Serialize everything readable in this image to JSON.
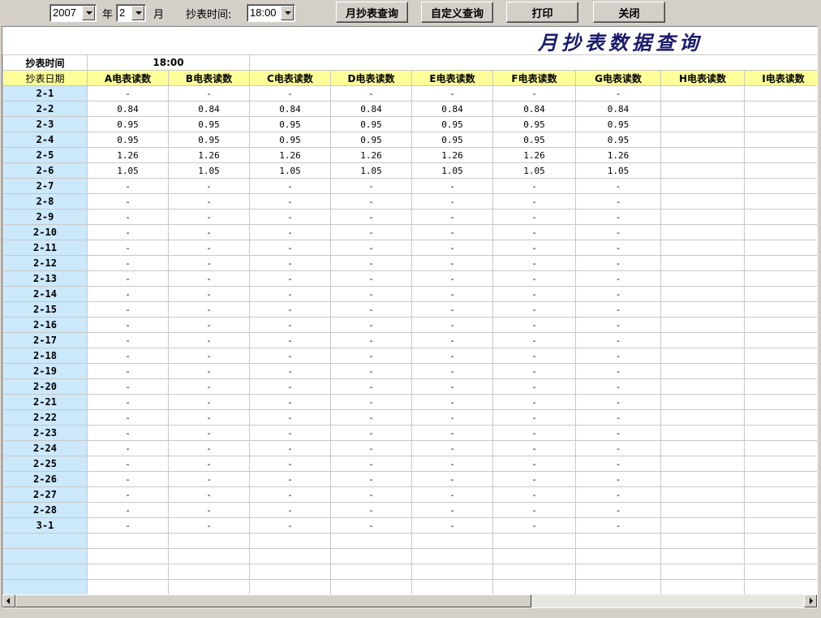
{
  "toolbar": {
    "year_value": "2007",
    "year_label": "年",
    "month_value": "2",
    "month_label": "月",
    "time_label": "抄表时间:",
    "time_value": "18:00",
    "buttons": {
      "monthly_query": "月抄表查询",
      "custom_query": "自定义查询",
      "print": "打印",
      "close": "关闭"
    }
  },
  "report": {
    "title": "月抄表数据查询",
    "time_header_label": "抄表时间",
    "time_header_value": "18:00",
    "date_col_header": "抄表日期",
    "columns": [
      "A电表读数",
      "B电表读数",
      "C电表读数",
      "D电表读数",
      "E电表读数",
      "F电表读数",
      "G电表读数",
      "H电表读数",
      "I电表读数"
    ],
    "rows": [
      {
        "date": "2-1",
        "values": [
          "-",
          "-",
          "-",
          "-",
          "-",
          "-",
          "-",
          "",
          ""
        ]
      },
      {
        "date": "2-2",
        "values": [
          "0.84",
          "0.84",
          "0.84",
          "0.84",
          "0.84",
          "0.84",
          "0.84",
          "",
          ""
        ]
      },
      {
        "date": "2-3",
        "values": [
          "0.95",
          "0.95",
          "0.95",
          "0.95",
          "0.95",
          "0.95",
          "0.95",
          "",
          ""
        ]
      },
      {
        "date": "2-4",
        "values": [
          "0.95",
          "0.95",
          "0.95",
          "0.95",
          "0.95",
          "0.95",
          "0.95",
          "",
          ""
        ]
      },
      {
        "date": "2-5",
        "values": [
          "1.26",
          "1.26",
          "1.26",
          "1.26",
          "1.26",
          "1.26",
          "1.26",
          "",
          ""
        ]
      },
      {
        "date": "2-6",
        "values": [
          "1.05",
          "1.05",
          "1.05",
          "1.05",
          "1.05",
          "1.05",
          "1.05",
          "",
          ""
        ]
      },
      {
        "date": "2-7",
        "values": [
          "-",
          "-",
          "-",
          "-",
          "-",
          "-",
          "-",
          "",
          ""
        ]
      },
      {
        "date": "2-8",
        "values": [
          "-",
          "-",
          "-",
          "-",
          "-",
          "-",
          "-",
          "",
          ""
        ]
      },
      {
        "date": "2-9",
        "values": [
          "-",
          "-",
          "-",
          "-",
          "-",
          "-",
          "-",
          "",
          ""
        ]
      },
      {
        "date": "2-10",
        "values": [
          "-",
          "-",
          "-",
          "-",
          "-",
          "-",
          "-",
          "",
          ""
        ]
      },
      {
        "date": "2-11",
        "values": [
          "-",
          "-",
          "-",
          "-",
          "-",
          "-",
          "-",
          "",
          ""
        ]
      },
      {
        "date": "2-12",
        "values": [
          "-",
          "-",
          "-",
          "-",
          "-",
          "-",
          "-",
          "",
          ""
        ]
      },
      {
        "date": "2-13",
        "values": [
          "-",
          "-",
          "-",
          "-",
          "-",
          "-",
          "-",
          "",
          ""
        ]
      },
      {
        "date": "2-14",
        "values": [
          "-",
          "-",
          "-",
          "-",
          "-",
          "-",
          "-",
          "",
          ""
        ]
      },
      {
        "date": "2-15",
        "values": [
          "-",
          "-",
          "-",
          "-",
          "-",
          "-",
          "-",
          "",
          ""
        ]
      },
      {
        "date": "2-16",
        "values": [
          "-",
          "-",
          "-",
          "-",
          "-",
          "-",
          "-",
          "",
          ""
        ]
      },
      {
        "date": "2-17",
        "values": [
          "-",
          "-",
          "-",
          "-",
          "-",
          "-",
          "-",
          "",
          ""
        ]
      },
      {
        "date": "2-18",
        "values": [
          "-",
          "-",
          "-",
          "-",
          "-",
          "-",
          "-",
          "",
          ""
        ]
      },
      {
        "date": "2-19",
        "values": [
          "-",
          "-",
          "-",
          "-",
          "-",
          "-",
          "-",
          "",
          ""
        ]
      },
      {
        "date": "2-20",
        "values": [
          "-",
          "-",
          "-",
          "-",
          "-",
          "-",
          "-",
          "",
          ""
        ]
      },
      {
        "date": "2-21",
        "values": [
          "-",
          "-",
          "-",
          "-",
          "-",
          "-",
          "-",
          "",
          ""
        ]
      },
      {
        "date": "2-22",
        "values": [
          "-",
          "-",
          "-",
          "-",
          "-",
          "-",
          "-",
          "",
          ""
        ]
      },
      {
        "date": "2-23",
        "values": [
          "-",
          "-",
          "-",
          "-",
          "-",
          "-",
          "-",
          "",
          ""
        ]
      },
      {
        "date": "2-24",
        "values": [
          "-",
          "-",
          "-",
          "-",
          "-",
          "-",
          "-",
          "",
          ""
        ]
      },
      {
        "date": "2-25",
        "values": [
          "-",
          "-",
          "-",
          "-",
          "-",
          "-",
          "-",
          "",
          ""
        ]
      },
      {
        "date": "2-26",
        "values": [
          "-",
          "-",
          "-",
          "-",
          "-",
          "-",
          "-",
          "",
          ""
        ]
      },
      {
        "date": "2-27",
        "values": [
          "-",
          "-",
          "-",
          "-",
          "-",
          "-",
          "-",
          "",
          ""
        ]
      },
      {
        "date": "2-28",
        "values": [
          "-",
          "-",
          "-",
          "-",
          "-",
          "-",
          "-",
          "",
          ""
        ]
      },
      {
        "date": "3-1",
        "values": [
          "-",
          "-",
          "-",
          "-",
          "-",
          "-",
          "-",
          "",
          ""
        ]
      }
    ],
    "blank_rows": 4
  },
  "colors": {
    "window_bg": "#d4d0c8",
    "date_col_bg": "#cce8fb",
    "header_row_bg": "#ffff99",
    "title_color": "#1a1a6e"
  },
  "icons": {
    "dropdown": "chevron-down-icon",
    "scroll_left": "arrow-left-icon",
    "scroll_right": "arrow-right-icon"
  }
}
